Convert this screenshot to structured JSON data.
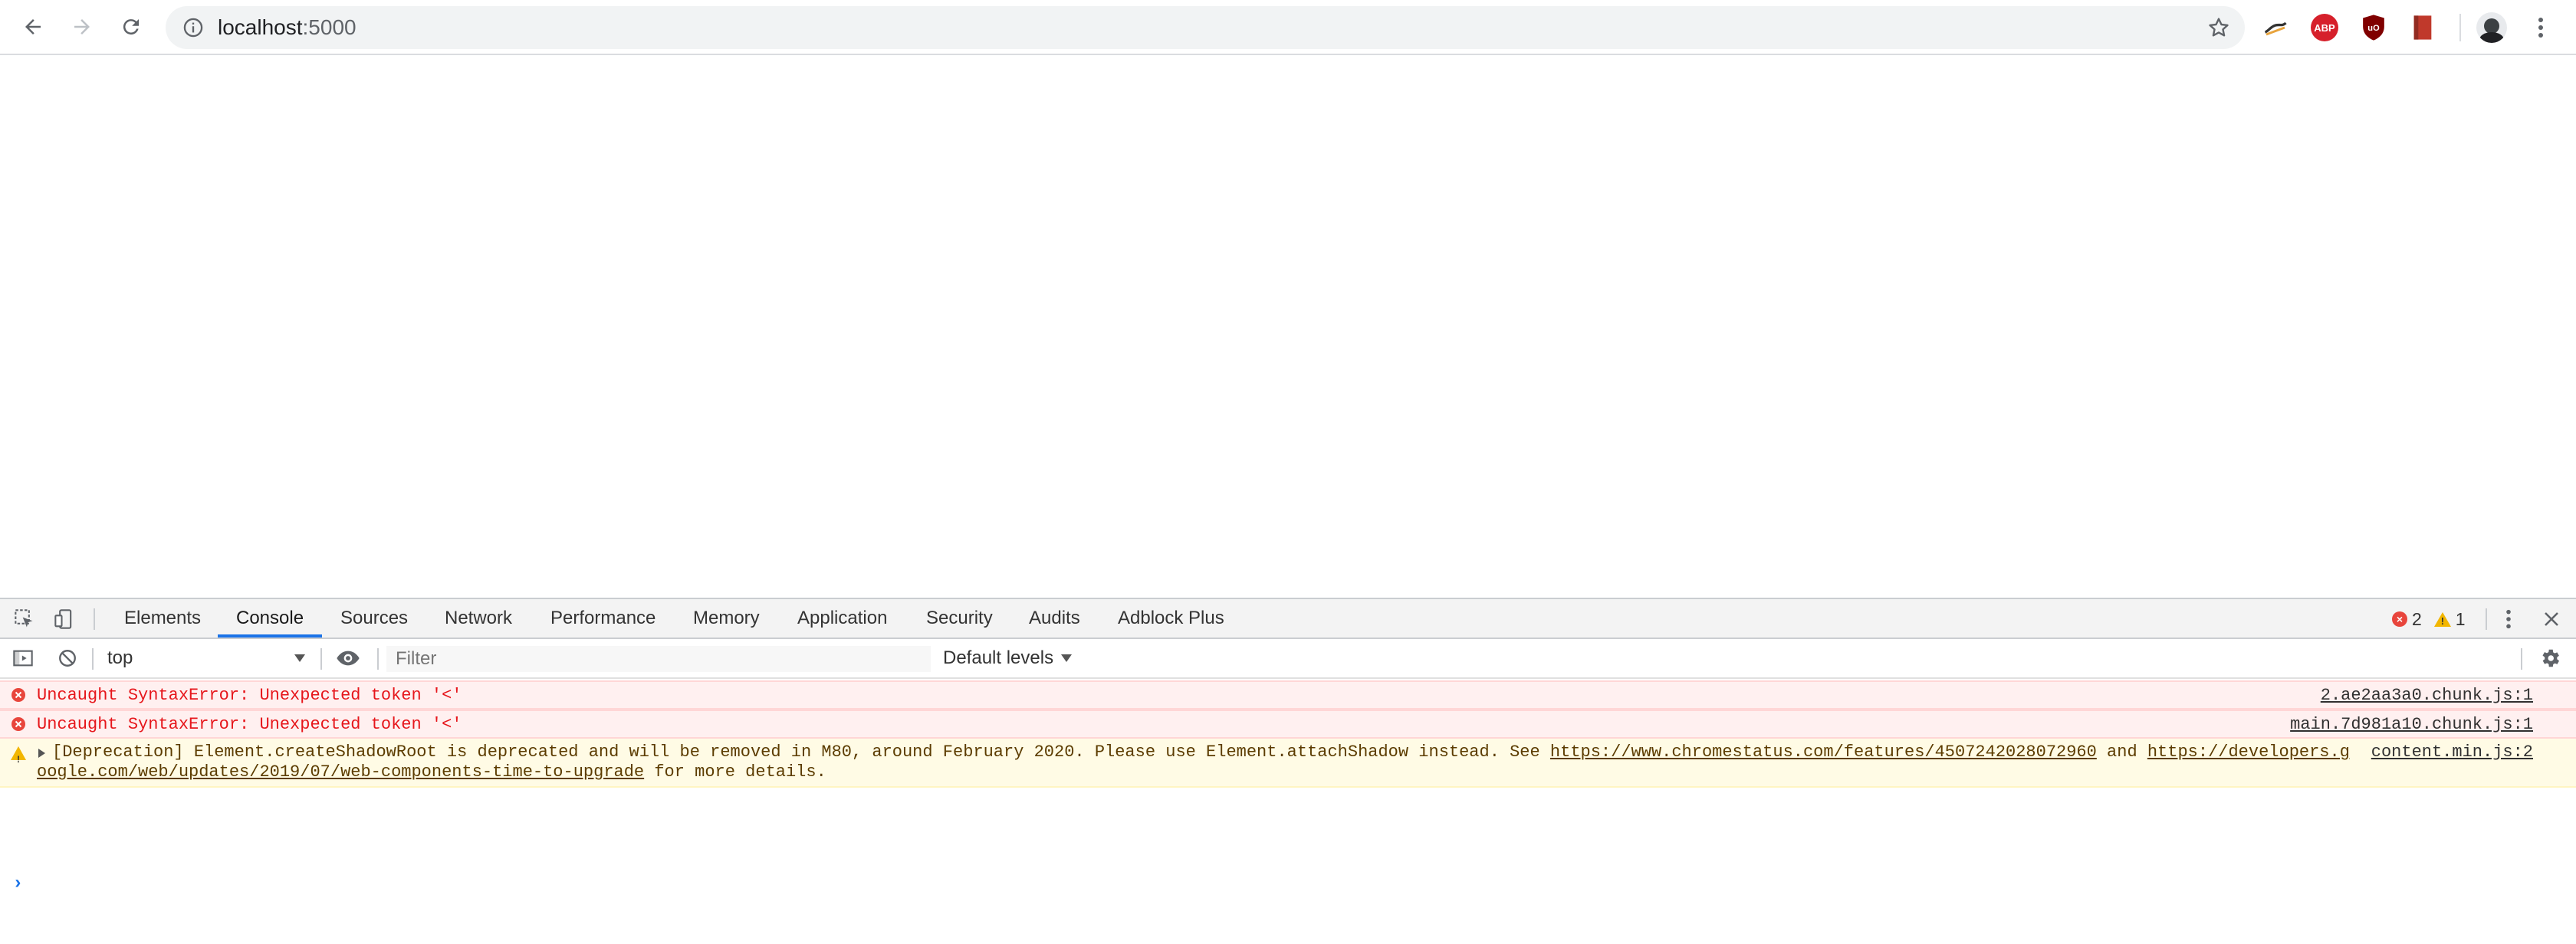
{
  "browser": {
    "url_host": "localhost",
    "url_port": ":5000",
    "extensions": [
      "sniff-icon",
      "adblock-plus-icon",
      "ublock-origin-icon",
      "bookmark-icon"
    ],
    "abp_label": "ABP",
    "ublock_label": "uO"
  },
  "devtools": {
    "tabs": [
      {
        "label": "Elements"
      },
      {
        "label": "Console"
      },
      {
        "label": "Sources"
      },
      {
        "label": "Network"
      },
      {
        "label": "Performance"
      },
      {
        "label": "Memory"
      },
      {
        "label": "Application"
      },
      {
        "label": "Security"
      },
      {
        "label": "Audits"
      },
      {
        "label": "Adblock Plus"
      }
    ],
    "active_tab": "Console",
    "error_count": "2",
    "warning_count": "1"
  },
  "console_toolbar": {
    "context": "top",
    "filter_placeholder": "Filter",
    "levels": "Default levels"
  },
  "messages": [
    {
      "level": "error",
      "text": "Uncaught SyntaxError: Unexpected token '<'",
      "source": "2.ae2aa3a0.chunk.js:1"
    },
    {
      "level": "error",
      "text": "Uncaught SyntaxError: Unexpected token '<'",
      "source": "main.7d981a10.chunk.js:1"
    },
    {
      "level": "warning",
      "text_prefix": "[Deprecation] Element.createShadowRoot is deprecated and will be removed in M80, around February 2020. Please use Element.attachShadow instead. See ",
      "link1": "https://www.chromestatus.com/features/4507242028072960",
      "middle": " and ",
      "link2_line1": "https://developers.g",
      "link2_line2": "oogle.com/web/updates/2019/07/web-components-time-to-upgrade",
      "suffix": " for more details.",
      "source": "content.min.js:2"
    }
  ],
  "colors": {
    "error_text": "#e6161b",
    "warning_bg": "#fffbe5",
    "active_tab_underline": "#1a73e8"
  }
}
